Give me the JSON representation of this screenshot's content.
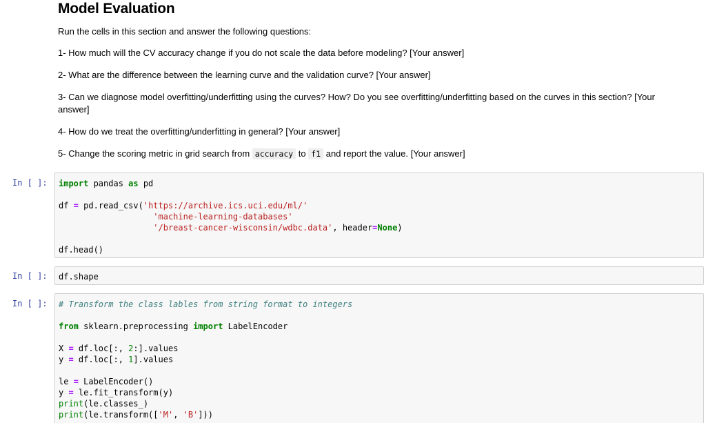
{
  "markdown": {
    "title": "Model Evaluation",
    "intro": "Run the cells in this section and answer the following questions:",
    "q1": "1- How much will the CV accuracy change if you do not scale the data before modeling? [Your answer]",
    "q2": "2- What are the difference between the learning curve and the validation curve? [Your answer]",
    "q3": "3- Can we diagnose model overfitting/underfitting using the curves? How? Do you see overfitting/underfitting based on the curves in this section? [Your answer]",
    "q4": "4- How do we treat the overfitting/underfitting in general? [Your answer]",
    "q5_pre": "5- Change the scoring metric in grid search from ",
    "q5_code1": "accuracy",
    "q5_mid": " to ",
    "q5_code2": "f1",
    "q5_post": " and report the value. [Your answer]"
  },
  "cells": [
    {
      "prompt": "In [ ]:",
      "t": {
        "import": "import",
        "pandas": " pandas ",
        "as": "as",
        "pd": " pd",
        "df_assign": "df ",
        "eq": "=",
        "read_csv": " pd.read_csv(",
        "url1": "'https://archive.ics.uci.edu/ml/'",
        "indent": "                   ",
        "url2": "'machine-learning-databases'",
        "url3": "'/breast-cancer-wisconsin/wdbc.data'",
        "header": ", header",
        "none": "None",
        "close": ")",
        "head": "df.head()"
      }
    },
    {
      "prompt": "In [ ]:",
      "t": {
        "shape": "df.shape"
      }
    },
    {
      "prompt": "In [ ]:",
      "t": {
        "comment": "# Transform the class lables from string format to integers",
        "from": "from",
        "module": " sklearn.preprocessing ",
        "import": "import",
        "cls": " LabelEncoder",
        "X": "X ",
        "eq": "=",
        "xloc": " df.loc[:, ",
        "two": "2",
        "xend": ":].values",
        "y": "y ",
        "yloc": " df.loc[:, ",
        "one": "1",
        "yend": "].values",
        "le": "le ",
        "leinit": " LabelEncoder()",
        "fit": " le.fit_transform(y)",
        "print": "print",
        "classes": "(le.classes_)",
        "trans_pre": "(le.transform([",
        "m": "'M'",
        "comma": ", ",
        "b": "'B'",
        "trans_post": "]))"
      }
    }
  ]
}
